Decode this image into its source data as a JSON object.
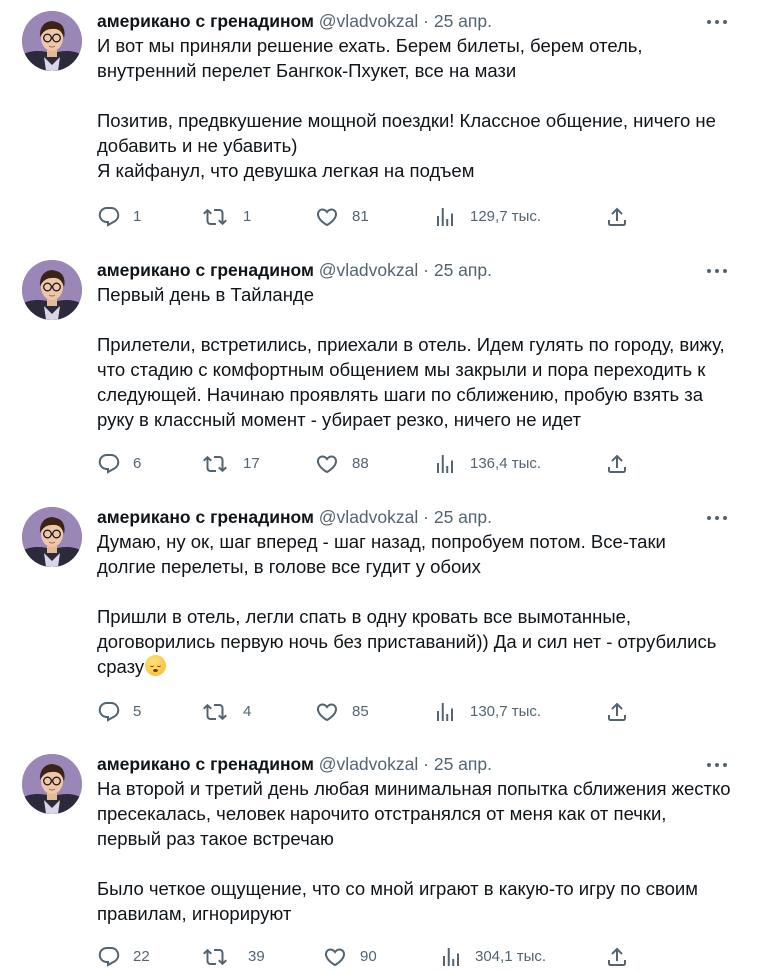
{
  "tweets": [
    {
      "author_name": "американо с гренадином",
      "handle": "@vladvokzal",
      "separator": "·",
      "date": "25 апр.",
      "paragraphs": [
        "И вот мы приняли решение ехать. Берем билеты, берем отель,\nвнутренний перелет Бангкок-Пхукет, все на мази",
        "Позитив, предвкушение мощной поездки! Классное общение, ничего не\nдобавить и не убавить)\nЯ кайфанул, что девушка легкая на подъем"
      ],
      "replies": "1",
      "retweets": "1",
      "likes": "81",
      "views": "129,7 тыс."
    },
    {
      "author_name": "американо с гренадином",
      "handle": "@vladvokzal",
      "separator": "·",
      "date": "25 апр.",
      "paragraphs": [
        "Первый день в Тайланде",
        "Прилетели, встретились, приехали в отель. Идем гулять по городу, вижу,\nчто стадию с комфортным общением мы закрыли и пора переходить к\nследующей. Начинаю проявлять шаги по сближению, пробую взять за\nруку в классный момент - убирает резко, ничего не идет"
      ],
      "replies": "6",
      "retweets": "17",
      "likes": "88",
      "views": "136,4 тыс."
    },
    {
      "author_name": "американо с гренадином",
      "handle": "@vladvokzal",
      "separator": "·",
      "date": "25 апр.",
      "paragraphs": [
        "Думаю, ну ок, шаг вперед - шаг назад, попробуем потом. Все-таки\nдолгие перелеты, в голове все гудит у обоих",
        "Пришли в отель, легли спать в одну кровать все вымотанные,\nдоговорились первую ночь без приставаний)) Да и сил нет - отрубились\nсразу"
      ],
      "emoji_after_last_paragraph": "sleeping-face-emoji",
      "replies": "5",
      "retweets": "4",
      "likes": "85",
      "views": "130,7 тыс."
    },
    {
      "author_name": "американо с гренадином",
      "handle": "@vladvokzal",
      "separator": "·",
      "date": "25 апр.",
      "paragraphs": [
        "На второй и третий день любая минимальная попытка сближения жестко\nпресекалась, человек нарочито отстранялся от меня как от печки,\nпервый раз такое встречаю",
        "Было четкое ощущение, что со мной играют в какую-то игру по своим\nправилам, игнорируют"
      ],
      "replies": "22",
      "retweets": "39",
      "likes": "90",
      "views": "304,1 тыс."
    }
  ],
  "icons": {
    "reply": "reply-icon",
    "retweet": "retweet-icon",
    "like": "heart-icon",
    "views": "views-icon",
    "share": "share-icon",
    "more": "more-icon"
  },
  "colors": {
    "text": "#0f1419",
    "secondary": "#536471",
    "avatar_bg": "#9b86b8"
  }
}
